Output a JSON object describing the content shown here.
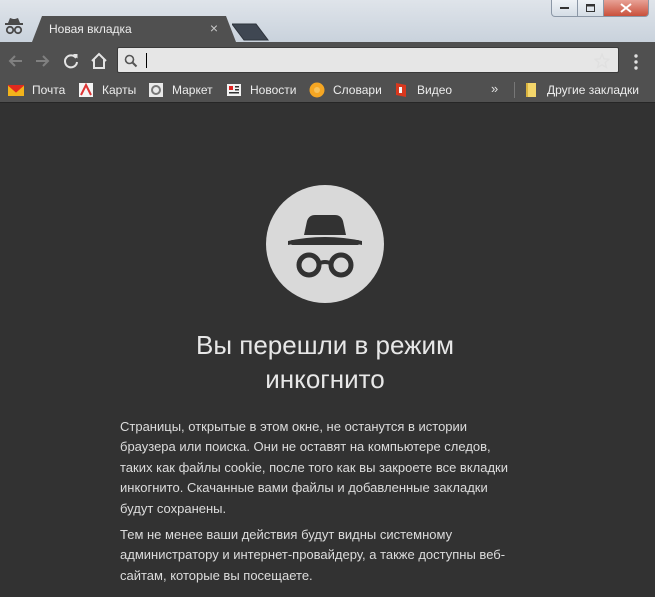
{
  "tab": {
    "title": "Новая вкладка",
    "close_label": "×"
  },
  "window": {
    "minimize_icon": "minimize-icon",
    "maximize_icon": "maximize-icon",
    "close_icon": "close-icon"
  },
  "toolbar": {
    "back_icon": "back-arrow-icon",
    "forward_icon": "forward-arrow-icon",
    "reload_icon": "reload-icon",
    "home_icon": "home-icon",
    "omnibox": {
      "value": "",
      "placeholder": ""
    },
    "star_icon": "star-icon",
    "menu_icon": "menu-dots-icon"
  },
  "bookmarks": {
    "items": [
      {
        "label": "Почта",
        "icon": "mail-icon"
      },
      {
        "label": "Карты",
        "icon": "maps-icon"
      },
      {
        "label": "Маркет",
        "icon": "market-icon"
      },
      {
        "label": "Новости",
        "icon": "news-icon"
      },
      {
        "label": "Словари",
        "icon": "dictionary-icon"
      },
      {
        "label": "Видео",
        "icon": "video-icon"
      }
    ],
    "more_label": "»",
    "other_label": "Другие закладки"
  },
  "content": {
    "heading_line1": "Вы перешли в режим",
    "heading_line2": "инкогнито",
    "paragraph1": "Страницы, открытые в этом окне, не останутся в истории браузера или поиска. Они не оставят на компьютере следов, таких как файлы cookie, после того как вы закроете все вкладки инкогнито. Скачанные вами файлы и добавленные закладки будут сохранены.",
    "paragraph2": "Тем не менее ваши действия будут видны системному администратору и интернет-провайдеру, а также доступны веб-сайтам, которые вы посещаете."
  },
  "colors": {
    "background": "#323232",
    "toolbar": "#505050",
    "incognito_circle": "#d9d9d9",
    "text": "#dcdcdc"
  }
}
